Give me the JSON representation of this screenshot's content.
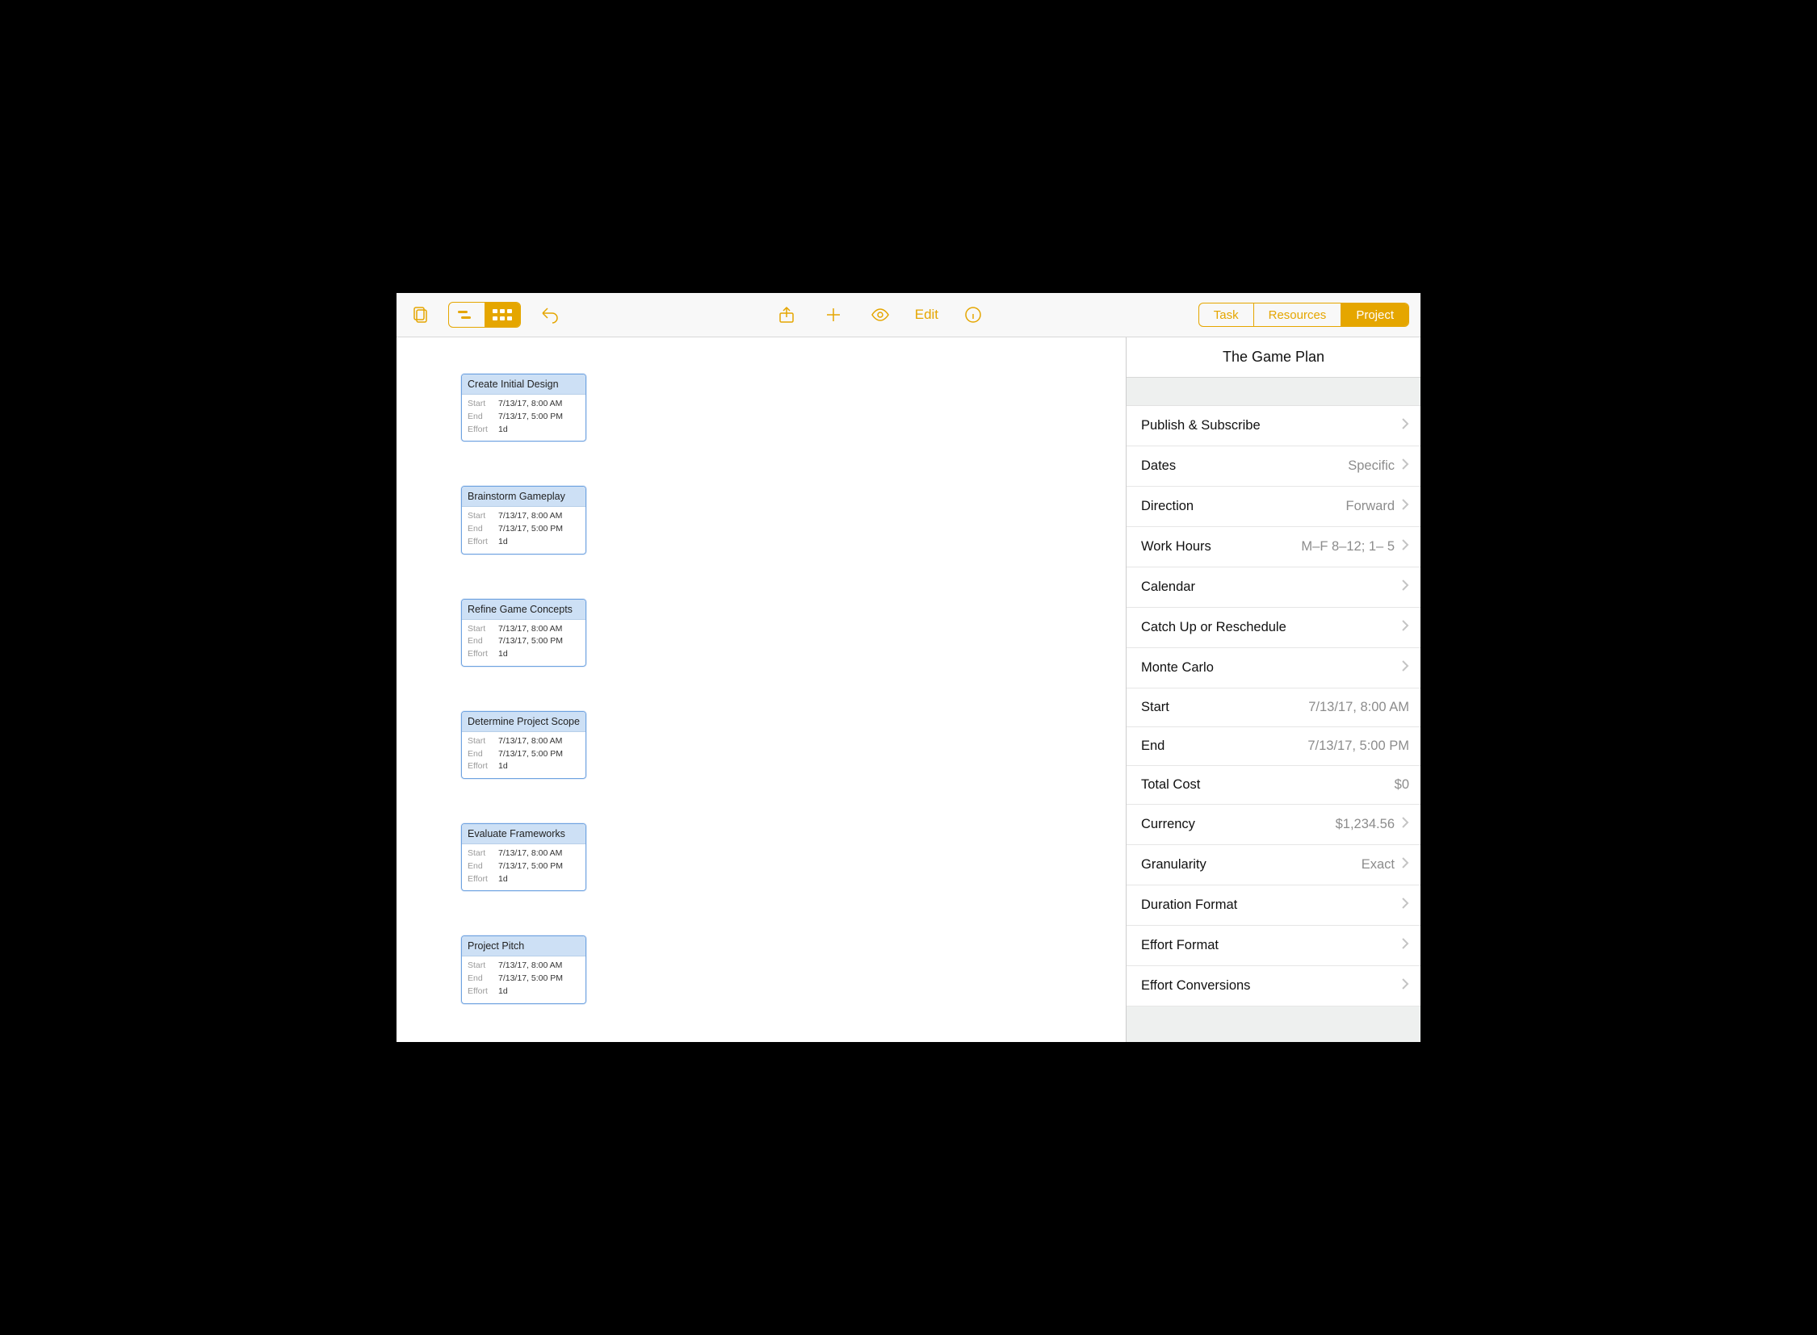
{
  "toolbar": {
    "edit_label": "Edit",
    "segments": {
      "task": "Task",
      "resources": "Resources",
      "project": "Project",
      "active": "project"
    }
  },
  "canvas": {
    "labels": {
      "start": "Start",
      "end": "End",
      "effort": "Effort"
    },
    "tasks": [
      {
        "title": "Create Initial Design",
        "start": "7/13/17, 8:00 AM",
        "end": "7/13/17, 5:00 PM",
        "effort": "1d"
      },
      {
        "title": "Brainstorm Gameplay",
        "start": "7/13/17, 8:00 AM",
        "end": "7/13/17, 5:00 PM",
        "effort": "1d"
      },
      {
        "title": "Refine Game Concepts",
        "start": "7/13/17, 8:00 AM",
        "end": "7/13/17, 5:00 PM",
        "effort": "1d"
      },
      {
        "title": "Determine Project Scope",
        "start": "7/13/17, 8:00 AM",
        "end": "7/13/17, 5:00 PM",
        "effort": "1d"
      },
      {
        "title": "Evaluate Frameworks",
        "start": "7/13/17, 8:00 AM",
        "end": "7/13/17, 5:00 PM",
        "effort": "1d"
      },
      {
        "title": "Project Pitch",
        "start": "7/13/17, 8:00 AM",
        "end": "7/13/17, 5:00 PM",
        "effort": "1d"
      }
    ]
  },
  "sidebar": {
    "title": "The Game Plan",
    "rows": [
      {
        "label": "Publish & Subscribe",
        "value": "",
        "chev": true
      },
      {
        "label": "Dates",
        "value": "Specific",
        "chev": true
      },
      {
        "label": "Direction",
        "value": "Forward",
        "chev": true
      },
      {
        "label": "Work Hours",
        "value": "M–F  8–12; 1– 5",
        "chev": true
      },
      {
        "label": "Calendar",
        "value": "",
        "chev": true
      },
      {
        "label": "Catch Up or Reschedule",
        "value": "",
        "chev": true
      },
      {
        "label": "Monte Carlo",
        "value": "",
        "chev": true
      },
      {
        "label": "Start",
        "value": "7/13/17, 8:00 AM",
        "chev": false
      },
      {
        "label": "End",
        "value": "7/13/17, 5:00 PM",
        "chev": false
      },
      {
        "label": "Total Cost",
        "value": "$0",
        "chev": false
      },
      {
        "label": "Currency",
        "value": "$1,234.56",
        "chev": true
      },
      {
        "label": "Granularity",
        "value": "Exact",
        "chev": true
      },
      {
        "label": "Duration Format",
        "value": "",
        "chev": true
      },
      {
        "label": "Effort Format",
        "value": "",
        "chev": true
      },
      {
        "label": "Effort Conversions",
        "value": "",
        "chev": true
      }
    ]
  }
}
